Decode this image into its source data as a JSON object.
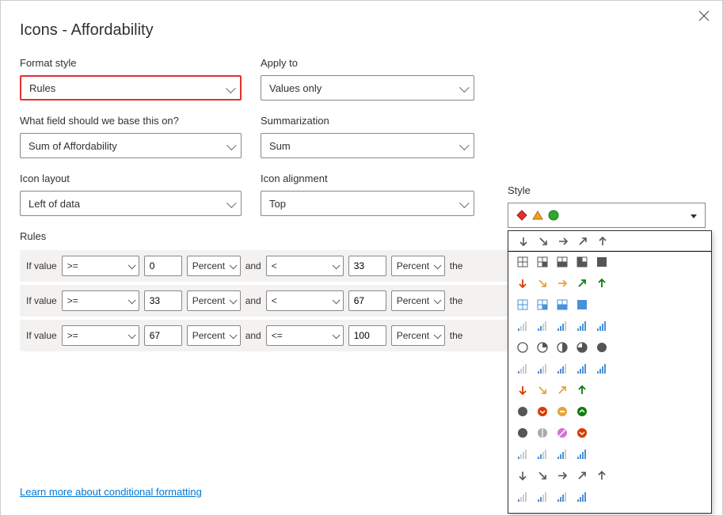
{
  "title": "Icons - Affordability",
  "labels": {
    "format_style": "Format style",
    "apply_to": "Apply to",
    "base_field": "What field should we base this on?",
    "summarization": "Summarization",
    "icon_layout": "Icon layout",
    "icon_alignment": "Icon alignment",
    "style": "Style",
    "rules": "Rules",
    "if_value": "If value",
    "and": "and",
    "then_truncated": "the"
  },
  "values": {
    "format_style": "Rules",
    "apply_to": "Values only",
    "base_field": "Sum of Affordability",
    "summarization": "Sum",
    "icon_layout": "Left of data",
    "icon_alignment": "Top"
  },
  "rules_list": [
    {
      "op1": ">=",
      "val1": "0",
      "unit1": "Percent",
      "op2": "<",
      "val2": "33",
      "unit2": "Percent"
    },
    {
      "op1": ">=",
      "val1": "33",
      "unit1": "Percent",
      "op2": "<",
      "val2": "67",
      "unit2": "Percent"
    },
    {
      "op1": ">=",
      "val1": "67",
      "unit1": "Percent",
      "op2": "<=",
      "val2": "100",
      "unit2": "Percent"
    }
  ],
  "style_selected": "diamond-triangle-circle",
  "style_options": [
    "arrows-gray-5",
    "quadrants-gray-5",
    "arrows-colored-5",
    "quadrants-blue-4",
    "signal-bars-blue-5a",
    "pie-slices-5",
    "signal-bars-blue-5b",
    "arrows-diag-colored-4",
    "circle-indicators-4",
    "circle-indicators-alt-4",
    "signal-bars-blue-4a",
    "arrows-gray-5b",
    "signal-bars-blue-4b"
  ],
  "link_text": "Learn more about conditional formatting"
}
